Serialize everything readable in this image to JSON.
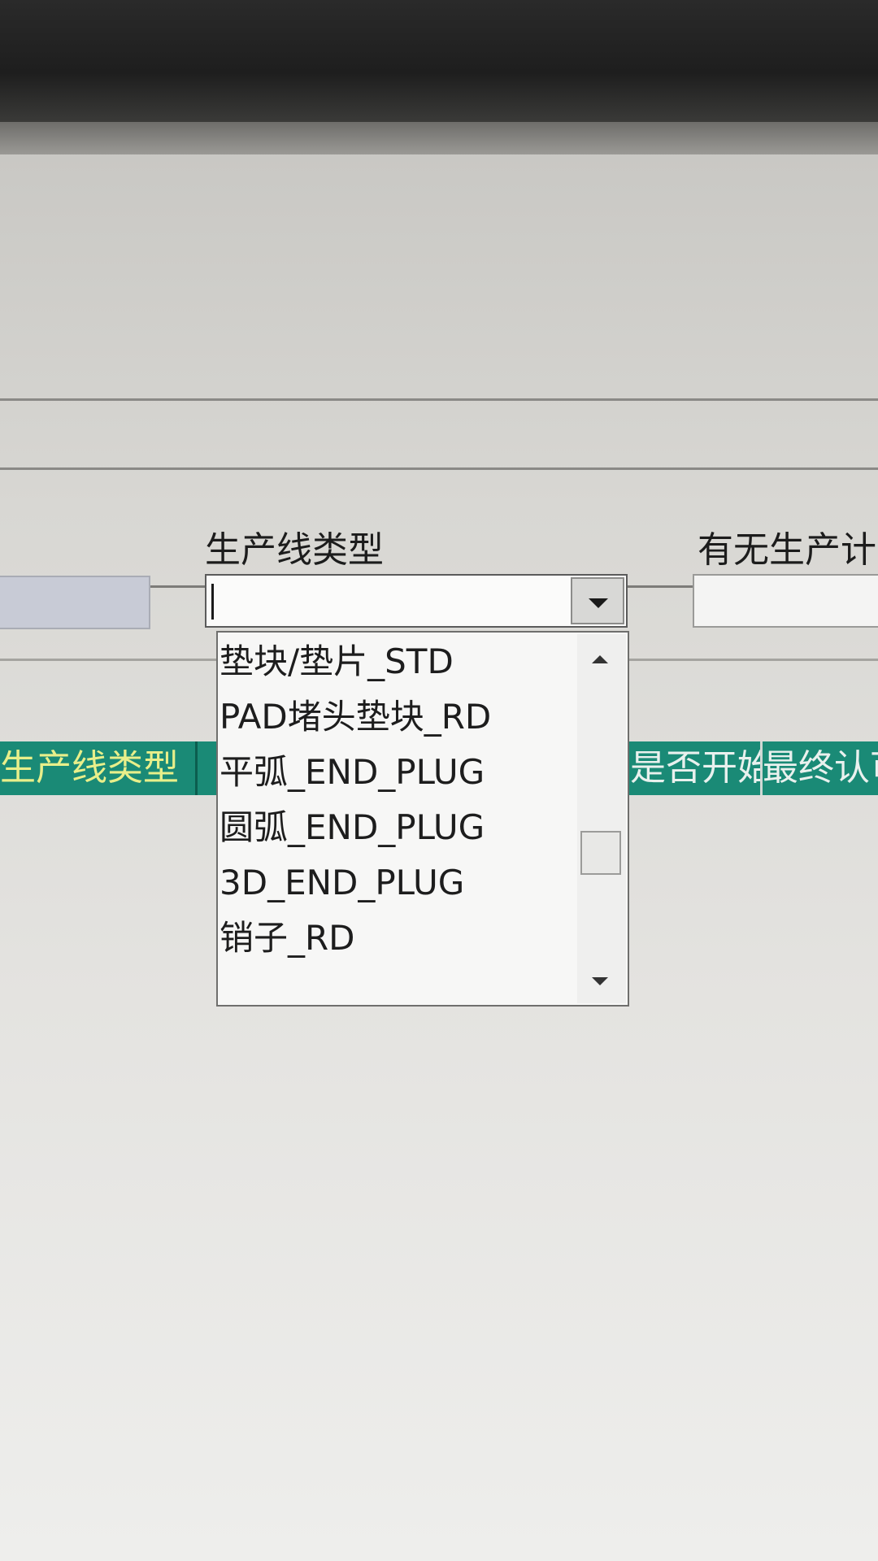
{
  "form": {
    "line_type_label": "生产线类型",
    "has_plan_label": "有无生产计",
    "line_type_value": ""
  },
  "dropdown": {
    "options": [
      "垫块/垫片_STD",
      "PAD堵头垫块_RD",
      "平弧_END_PLUG",
      "圆弧_END_PLUG",
      "3D_END_PLUG",
      "销子_RD"
    ]
  },
  "grid": {
    "headers": [
      "生产线类型",
      "是否开始",
      "最终认可"
    ]
  },
  "icons": {
    "combo_arrow": "chevron-down-icon",
    "scroll_up": "scroll-up-icon",
    "scroll_down": "scroll-down-icon"
  },
  "colors": {
    "grid_header_bg": "#1a8a76",
    "grid_header_text": "#e8ef8a"
  }
}
